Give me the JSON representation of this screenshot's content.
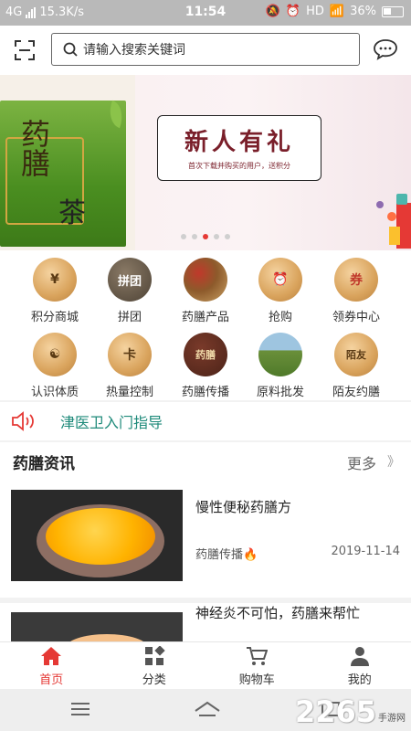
{
  "status_bar": {
    "network": "4G",
    "speed": "15.3K/s",
    "time": "11:54",
    "hd": "HD",
    "battery": "36%"
  },
  "search": {
    "placeholder": "请输入搜索关键词"
  },
  "banner": {
    "tea_name": "药膳",
    "tea_suffix": "茶",
    "promo_title": "新人有礼",
    "promo_subtitle": "首次下载并购买的用户，送积分",
    "dots_count": 5,
    "active_dot": 2
  },
  "grid": [
    {
      "label": "积分商城",
      "icon": "yen-coin-icon",
      "glyph": "¥"
    },
    {
      "label": "拼团",
      "icon": "group-buy-icon",
      "glyph": "拼团"
    },
    {
      "label": "药膳产品",
      "icon": "nuts-icon",
      "glyph": ""
    },
    {
      "label": "抢购",
      "icon": "alarm-clock-icon",
      "glyph": "⏰"
    },
    {
      "label": "领券中心",
      "icon": "coupon-icon",
      "glyph": "券"
    },
    {
      "label": "认识体质",
      "icon": "body-constitution-icon",
      "glyph": "☯"
    },
    {
      "label": "热量控制",
      "icon": "calorie-icon",
      "glyph": "卡"
    },
    {
      "label": "药膳传播",
      "icon": "herbal-book-icon",
      "glyph": "药膳"
    },
    {
      "label": "原料批发",
      "icon": "farmland-icon",
      "glyph": ""
    },
    {
      "label": "陌友约膳",
      "icon": "meetup-icon",
      "glyph": "陌友"
    }
  ],
  "notice": {
    "text": "津医卫入门指导"
  },
  "news": {
    "title": "药膳资讯",
    "more": "更多",
    "more_chevron": "》",
    "items": [
      {
        "headline": "慢性便秘药膳方",
        "source": "药膳传播🔥",
        "date": "2019-11-14"
      },
      {
        "headline": "神经炎不可怕，药膳来帮忙",
        "source": "",
        "date": ""
      }
    ]
  },
  "tabs": [
    {
      "label": "首页",
      "icon": "home-icon"
    },
    {
      "label": "分类",
      "icon": "category-icon"
    },
    {
      "label": "购物车",
      "icon": "cart-icon"
    },
    {
      "label": "我的",
      "icon": "user-icon"
    }
  ],
  "watermark": {
    "big": "2265",
    "small": "手游网"
  },
  "colors": {
    "accent": "#e53935",
    "notice_text": "#1e8a7a"
  }
}
